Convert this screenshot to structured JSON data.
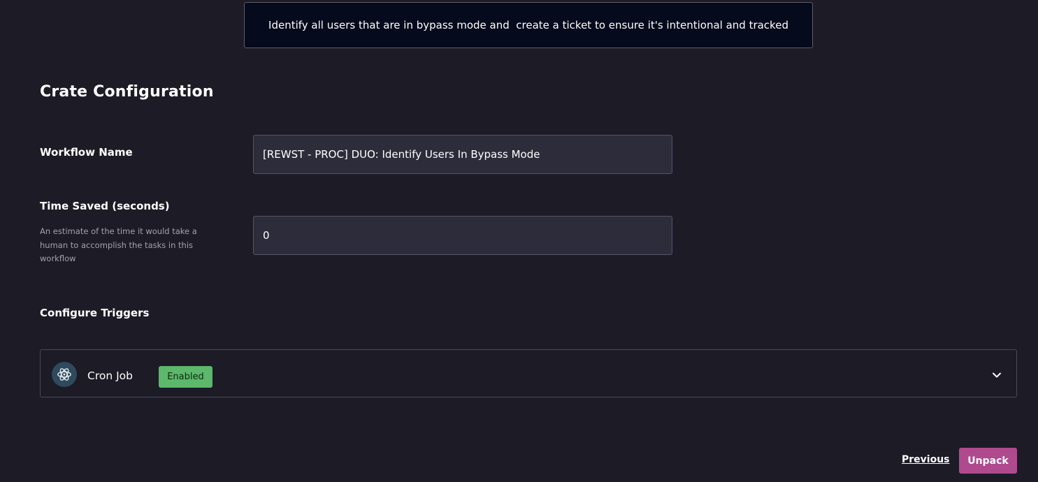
{
  "description": "Identify all users that are in bypass mode and  create a ticket to ensure it's intentional and tracked",
  "crate_config": {
    "title": "Crate Configuration",
    "workflow_name": {
      "label": "Workflow Name",
      "value": "[REWST - PROC] DUO: Identify Users In Bypass Mode"
    },
    "time_saved": {
      "label": "Time Saved (seconds)",
      "help": "An estimate of the time it would take a human to accomplish the tasks in this workflow",
      "value": "0"
    },
    "triggers": {
      "label": "Configure Triggers",
      "items": [
        {
          "name": "Cron Job",
          "status": "Enabled",
          "status_color": "#5cb86a",
          "icon": "atom-icon",
          "expand_icon": "chevron-down-icon"
        }
      ]
    }
  },
  "footer": {
    "previous_label": "Previous",
    "unpack_label": "Unpack",
    "unpack_color": "#b04a8f"
  }
}
